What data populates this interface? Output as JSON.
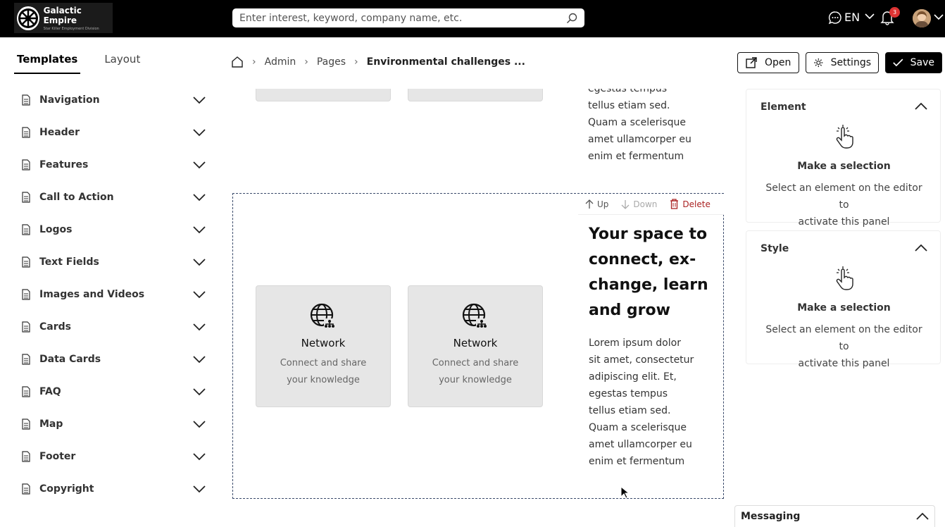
{
  "brand": {
    "name": "Galactic Empire",
    "tagline": "Star Killer Employment Division"
  },
  "search": {
    "placeholder": "Enter interest, keyword, company name, etc."
  },
  "header": {
    "language": "EN",
    "notifications": "3"
  },
  "left_tabs": [
    "Templates",
    "Layout"
  ],
  "templates": [
    "Navigation",
    "Header",
    "Features",
    "Call to Action",
    "Logos",
    "Text Fields",
    "Images and Videos",
    "Cards",
    "Data Cards",
    "FAQ",
    "Map",
    "Footer",
    "Copyright"
  ],
  "breadcrumb": {
    "items": [
      "Admin",
      "Pages"
    ],
    "current": "Environmental challenges ..."
  },
  "actions": {
    "open": "Open",
    "settings": "Settings",
    "save": "Save"
  },
  "canvas": {
    "top_text": [
      "egestas tempus",
      "tellus etiam sed.",
      "Quam a scelerisque",
      "amet ullamcorper eu",
      "enim et fermentum"
    ],
    "toolbar": {
      "up": "Up",
      "down": "Down",
      "delete": "Delete"
    },
    "heading_lines": [
      "Your space to",
      "connect, ex-",
      "change, learn",
      "and grow"
    ],
    "paragraph_lines": [
      "Lorem ipsum dolor",
      "sit amet, consectetur",
      "adipiscing elit. Et,",
      "egestas tempus",
      "tellus etiam sed.",
      "Quam a scelerisque",
      "amet ullamcorper eu",
      "enim et fermentum"
    ],
    "features": [
      {
        "title": "Network",
        "desc1": "Connect and share",
        "desc2": "your knowledge"
      },
      {
        "title": "Network",
        "desc1": "Connect and share",
        "desc2": "your knowledge"
      }
    ]
  },
  "panels": {
    "element": {
      "title": "Element",
      "heading": "Make a selection",
      "desc1": "Select an element on the editor to",
      "desc2": "activate this panel"
    },
    "style": {
      "title": "Style",
      "heading": "Make a selection",
      "desc1": "Select an element on the editor to",
      "desc2": "activate this panel"
    }
  },
  "messaging": {
    "label": "Messaging"
  }
}
